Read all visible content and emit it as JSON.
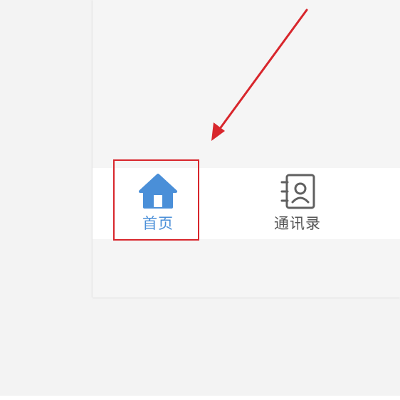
{
  "tabbar": {
    "tabs": [
      {
        "id": "home",
        "label": "首页",
        "icon": "home-icon",
        "active": true
      },
      {
        "id": "contacts",
        "label": "通讯录",
        "icon": "contacts-book-icon",
        "active": false
      }
    ]
  },
  "colors": {
    "active": "#4a8fd8",
    "inactive": "#555555",
    "annotation": "#d8262c",
    "page_background": "#f3f3f3",
    "app_background": "#f5f5f5"
  }
}
